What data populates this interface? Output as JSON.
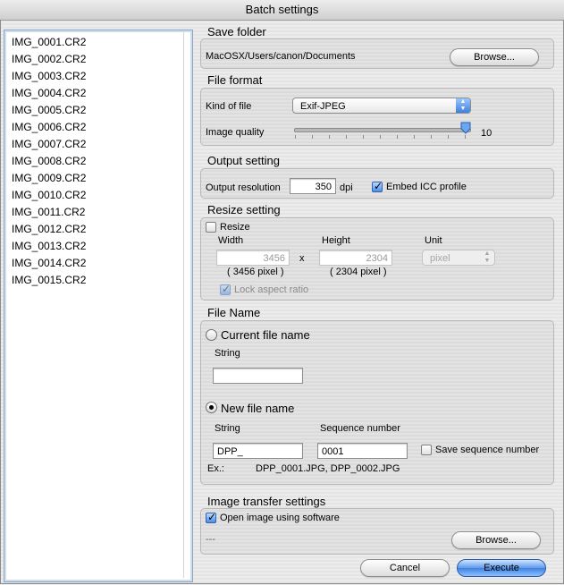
{
  "window": {
    "title": "Batch settings"
  },
  "file_list": [
    "IMG_0001.CR2",
    "IMG_0002.CR2",
    "IMG_0003.CR2",
    "IMG_0004.CR2",
    "IMG_0005.CR2",
    "IMG_0006.CR2",
    "IMG_0007.CR2",
    "IMG_0008.CR2",
    "IMG_0009.CR2",
    "IMG_0010.CR2",
    "IMG_0011.CR2",
    "IMG_0012.CR2",
    "IMG_0013.CR2",
    "IMG_0014.CR2",
    "IMG_0015.CR2"
  ],
  "save_folder": {
    "heading": "Save folder",
    "path": "MacOSX/Users/canon/Documents",
    "browse_label": "Browse..."
  },
  "file_format": {
    "heading": "File format",
    "kind_label": "Kind of file",
    "kind_value": "Exif-JPEG",
    "quality_label": "Image quality",
    "quality_value": "10",
    "quality_level": 10,
    "quality_max": 10
  },
  "output_setting": {
    "heading": "Output setting",
    "resolution_label": "Output resolution",
    "resolution_value": "350",
    "resolution_unit": "dpi",
    "embed_icc_label": "Embed ICC profile",
    "embed_icc_checked": true
  },
  "resize_setting": {
    "heading": "Resize setting",
    "resize_label": "Resize",
    "resize_checked": false,
    "width_label": "Width",
    "width_value": "3456",
    "width_pixel": "( 3456 pixel )",
    "times": "x",
    "height_label": "Height",
    "height_value": "2304",
    "height_pixel": "( 2304 pixel )",
    "unit_label": "Unit",
    "unit_value": "pixel",
    "lock_label": "Lock aspect ratio",
    "lock_checked": true
  },
  "file_name": {
    "heading": "File Name",
    "current_label": "Current file name",
    "current_string_label": "String",
    "current_string_value": "",
    "new_label": "New file name",
    "new_string_label": "String",
    "new_string_value": "DPP_",
    "sequence_label": "Sequence number",
    "sequence_value": "0001",
    "save_sequence_label": "Save sequence number",
    "save_sequence_checked": false,
    "example_label": "Ex.:",
    "example_value": "DPP_0001.JPG, DPP_0002.JPG"
  },
  "image_transfer": {
    "heading": "Image transfer settings",
    "open_label": "Open image using software",
    "open_checked": true,
    "software_value": "---",
    "browse_label": "Browse..."
  },
  "footer": {
    "cancel_label": "Cancel",
    "execute_label": "Execute"
  },
  "colors": {
    "accent": "#3f82e0",
    "list_border": "#8aa6c8"
  }
}
